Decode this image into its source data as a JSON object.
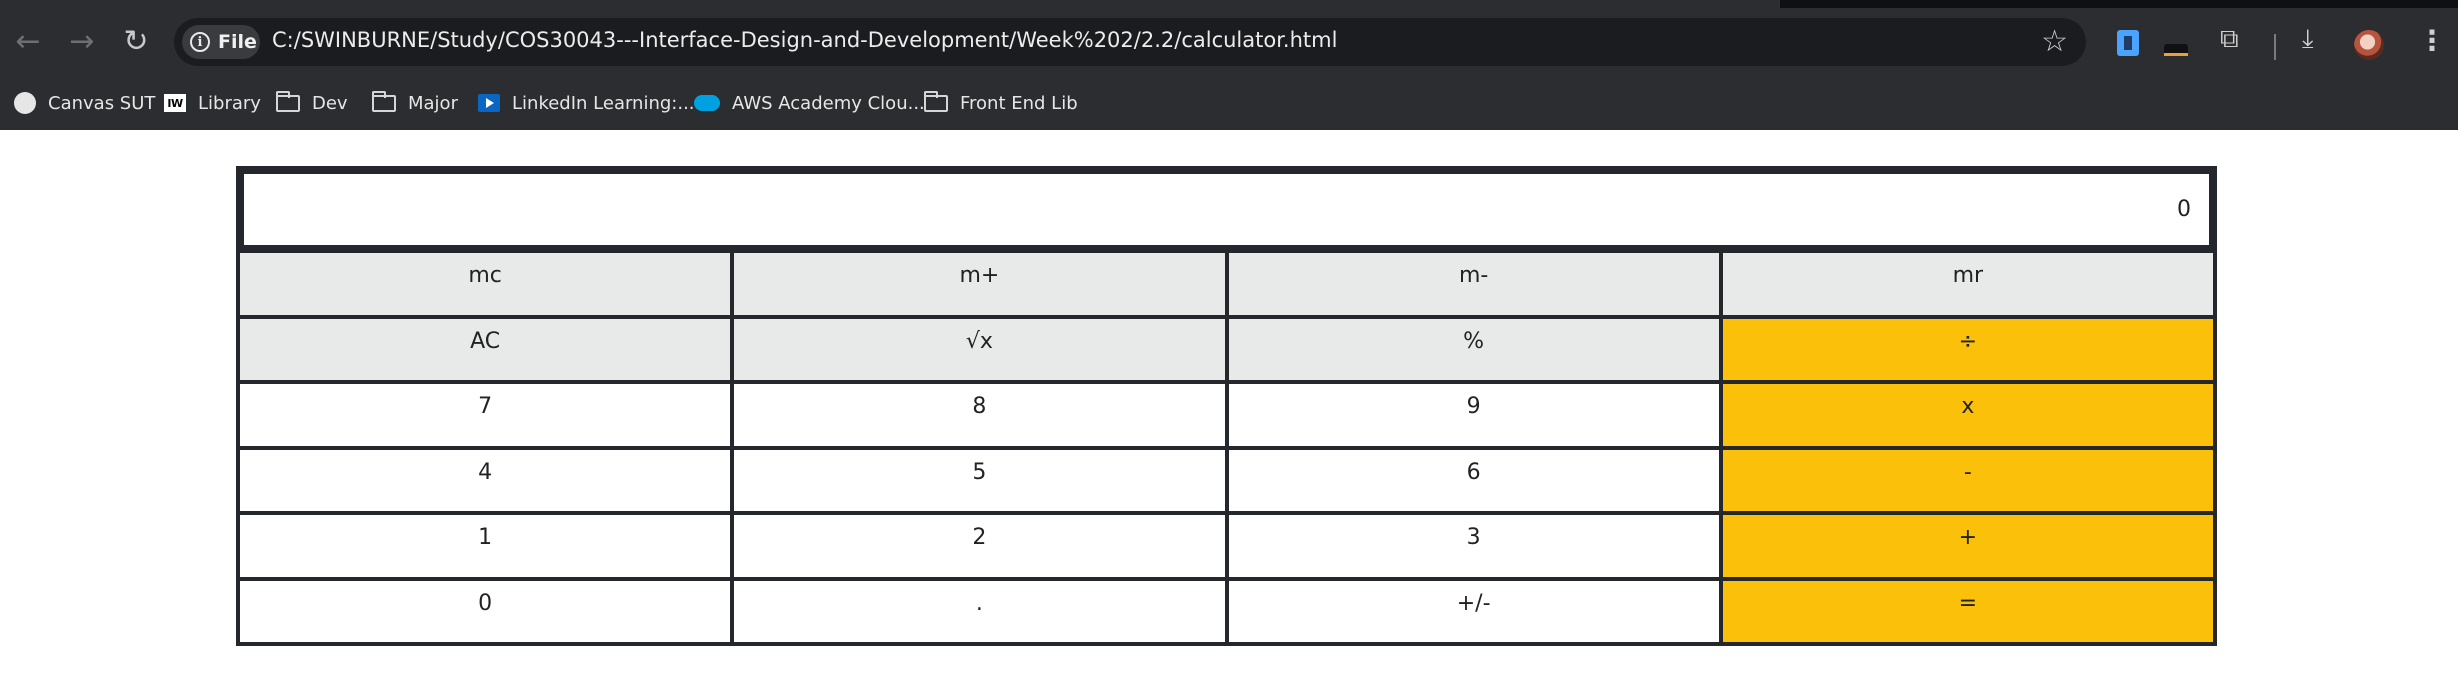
{
  "browser": {
    "address_bar": {
      "scheme_chip": "File",
      "url": "C:/SWINBURNE/Study/COS30043---Interface-Design-and-Development/Week%202/2.2/calculator.html"
    },
    "toolbar_icons": [
      "back-icon",
      "forward-icon",
      "reload-icon",
      "info-icon",
      "bookmark-star-icon",
      "extensions-icon",
      "download-icon",
      "profile-avatar",
      "more-menu-icon"
    ],
    "bookmarks": [
      {
        "label": "Canvas SUT",
        "icon": "globe-icon"
      },
      {
        "label": "Library",
        "icon": "iw-logo-icon"
      },
      {
        "label": "Dev",
        "icon": "folder-icon"
      },
      {
        "label": "Major",
        "icon": "folder-icon"
      },
      {
        "label": "LinkedIn Learning:...",
        "icon": "linkedin-learning-icon"
      },
      {
        "label": "AWS Academy Clou...",
        "icon": "salesforce-cloud-icon"
      },
      {
        "label": "Front End Lib",
        "icon": "folder-icon"
      }
    ]
  },
  "calculator": {
    "display": "0",
    "keys": [
      {
        "label": "mc",
        "kind": "mem"
      },
      {
        "label": "m+",
        "kind": "mem"
      },
      {
        "label": "m-",
        "kind": "mem"
      },
      {
        "label": "mr",
        "kind": "mem"
      },
      {
        "label": "AC",
        "kind": "func"
      },
      {
        "label": "√x",
        "kind": "func"
      },
      {
        "label": "%",
        "kind": "func"
      },
      {
        "label": "÷",
        "kind": "op"
      },
      {
        "label": "7",
        "kind": "num"
      },
      {
        "label": "8",
        "kind": "num"
      },
      {
        "label": "9",
        "kind": "num"
      },
      {
        "label": "x",
        "kind": "op"
      },
      {
        "label": "4",
        "kind": "num"
      },
      {
        "label": "5",
        "kind": "num"
      },
      {
        "label": "6",
        "kind": "num"
      },
      {
        "label": "-",
        "kind": "op"
      },
      {
        "label": "1",
        "kind": "num"
      },
      {
        "label": "2",
        "kind": "num"
      },
      {
        "label": "3",
        "kind": "num"
      },
      {
        "label": "+",
        "kind": "op"
      },
      {
        "label": "0",
        "kind": "num"
      },
      {
        "label": ".",
        "kind": "num"
      },
      {
        "label": "+/-",
        "kind": "num"
      },
      {
        "label": "=",
        "kind": "op"
      }
    ],
    "colors": {
      "memory_key_bg": "#e8e9e9",
      "number_key_bg": "#ffffff",
      "operator_key_bg": "#fbc10a",
      "grid_border": "#24282c"
    }
  }
}
